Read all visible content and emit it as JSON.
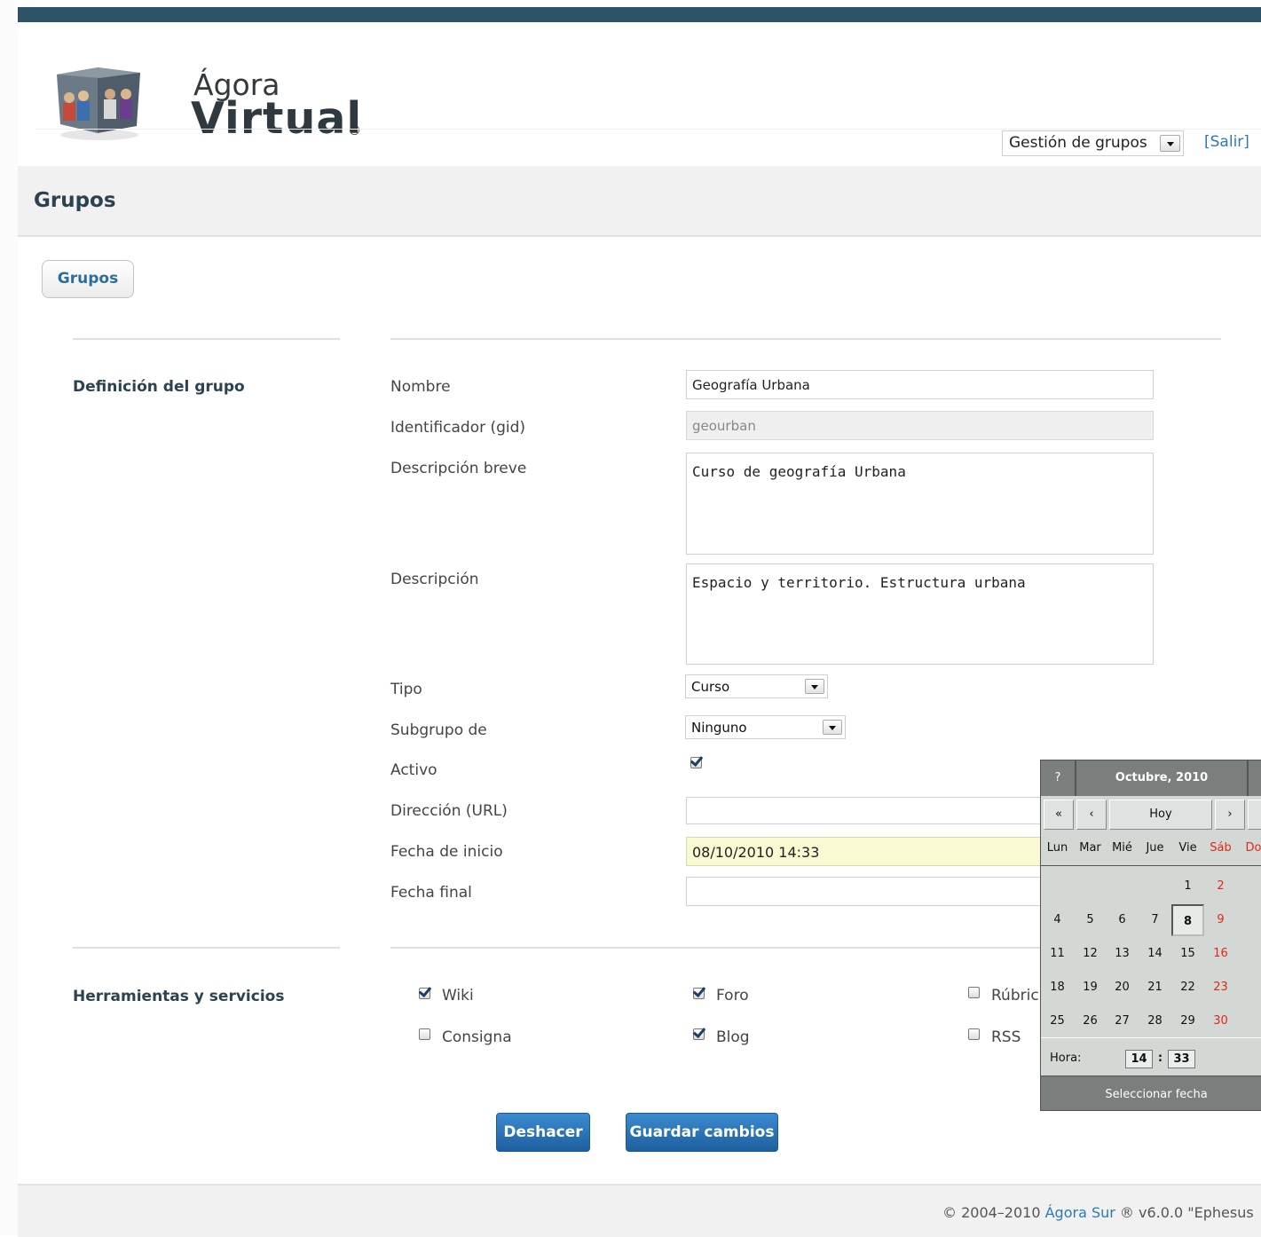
{
  "header": {
    "logo_line1": "Ágora",
    "logo_line2": "Virtual",
    "logo_reg": "®",
    "menu_select_value": "Gestión de grupos",
    "logout_label": "[Salir]"
  },
  "page": {
    "title": "Grupos",
    "tab_label": "Grupos"
  },
  "definition": {
    "section_label": "Definición del grupo",
    "fields": {
      "nombre": {
        "label": "Nombre",
        "value": "Geografía Urbana"
      },
      "gid": {
        "label": "Identificador (gid)",
        "value": "geourban"
      },
      "descripcion_breve": {
        "label": "Descripción breve",
        "value": "Curso de geografía Urbana"
      },
      "descripcion": {
        "label": "Descripción",
        "value": "Espacio y territorio. Estructura urbana"
      },
      "tipo": {
        "label": "Tipo",
        "value": "Curso"
      },
      "subgrupo": {
        "label": "Subgrupo de",
        "value": "Ninguno"
      },
      "activo": {
        "label": "Activo",
        "checked": true
      },
      "url": {
        "label": "Dirección (URL)",
        "value": ""
      },
      "fecha_inicio": {
        "label": "Fecha de inicio",
        "value": "08/10/2010 14:33"
      },
      "fecha_final": {
        "label": "Fecha final",
        "value": ""
      }
    }
  },
  "services": {
    "section_label": "Herramientas y servicios",
    "items": [
      {
        "label": "Wiki",
        "checked": true
      },
      {
        "label": "Foro",
        "checked": true
      },
      {
        "label": "Rúbric",
        "checked": false
      },
      {
        "label": "Consigna",
        "checked": false
      },
      {
        "label": "Blog",
        "checked": true
      },
      {
        "label": "RSS",
        "checked": false
      }
    ]
  },
  "buttons": {
    "undo": "Deshacer",
    "save": "Guardar cambios"
  },
  "calendar": {
    "help": "?",
    "month_title": "Octubre, 2010",
    "prev_year": "«",
    "prev_month": "‹",
    "today": "Hoy",
    "next_month": "›",
    "weekdays": [
      "Lun",
      "Mar",
      "Mié",
      "Jue",
      "Vie",
      "Sáb",
      "Do"
    ],
    "weeks": [
      [
        "",
        "",
        "",
        "",
        "1",
        "2",
        ""
      ],
      [
        "4",
        "5",
        "6",
        "7",
        "8",
        "9",
        ""
      ],
      [
        "11",
        "12",
        "13",
        "14",
        "15",
        "16",
        ""
      ],
      [
        "18",
        "19",
        "20",
        "21",
        "22",
        "23",
        ""
      ],
      [
        "25",
        "26",
        "27",
        "28",
        "29",
        "30",
        ""
      ]
    ],
    "selected_day": "8",
    "time_label": "Hora:",
    "hour": "14",
    "minute": "33",
    "time_sep": ":",
    "select_label": "Seleccionar fecha",
    "weekend_color": "#e0271a"
  },
  "footer": {
    "copyright": "© 2004–2010 ",
    "link": "Ágora Sur",
    "version": " ® v6.0.0 \"Ephesus"
  },
  "colors": {
    "topbar": "#2c5366",
    "link": "#2a7bb5",
    "button": "#2a74b8"
  }
}
